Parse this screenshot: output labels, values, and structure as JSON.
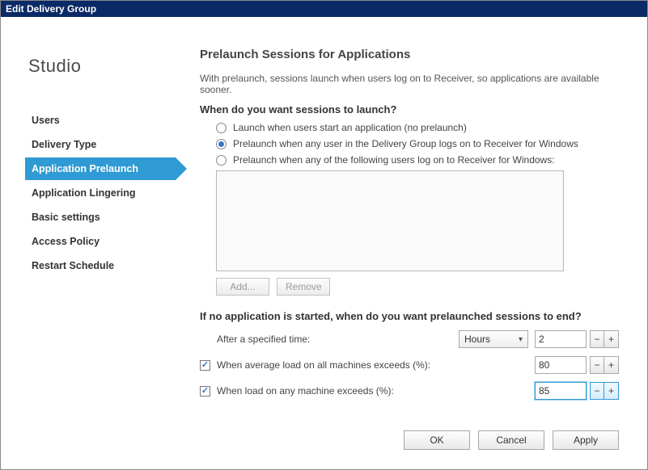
{
  "window": {
    "title": "Edit Delivery Group"
  },
  "brand": "Studio",
  "sidebar": {
    "items": [
      {
        "label": "Users",
        "selected": false
      },
      {
        "label": "Delivery Type",
        "selected": false
      },
      {
        "label": "Application Prelaunch",
        "selected": true
      },
      {
        "label": "Application Lingering",
        "selected": false
      },
      {
        "label": "Basic settings",
        "selected": false
      },
      {
        "label": "Access Policy",
        "selected": false
      },
      {
        "label": "Restart Schedule",
        "selected": false
      }
    ]
  },
  "page": {
    "title": "Prelaunch Sessions for Applications",
    "intro": "With prelaunch, sessions launch when users log on to Receiver, so applications are available sooner.",
    "launch_q": "When do you want sessions to launch?",
    "radios": [
      {
        "label": "Launch when users start an application (no prelaunch)",
        "selected": false
      },
      {
        "label": "Prelaunch when any user in the Delivery Group logs on to Receiver for Windows",
        "selected": true
      },
      {
        "label": "Prelaunch when any of the following users log on to Receiver for Windows:",
        "selected": false
      }
    ],
    "userlist_buttons": {
      "add": "Add...",
      "remove": "Remove"
    },
    "end_q": "If no application is started, when do you want prelaunched sessions to end?",
    "time_row": {
      "label": "After a specified time:",
      "unit": "Hours",
      "value": "2"
    },
    "avg_row": {
      "checked": true,
      "label": "When average load on all machines exceeds (%):",
      "value": "80"
    },
    "any_row": {
      "checked": true,
      "label": "When load on any machine exceeds (%):",
      "value": "85"
    }
  },
  "buttons": {
    "ok": "OK",
    "cancel": "Cancel",
    "apply": "Apply"
  }
}
